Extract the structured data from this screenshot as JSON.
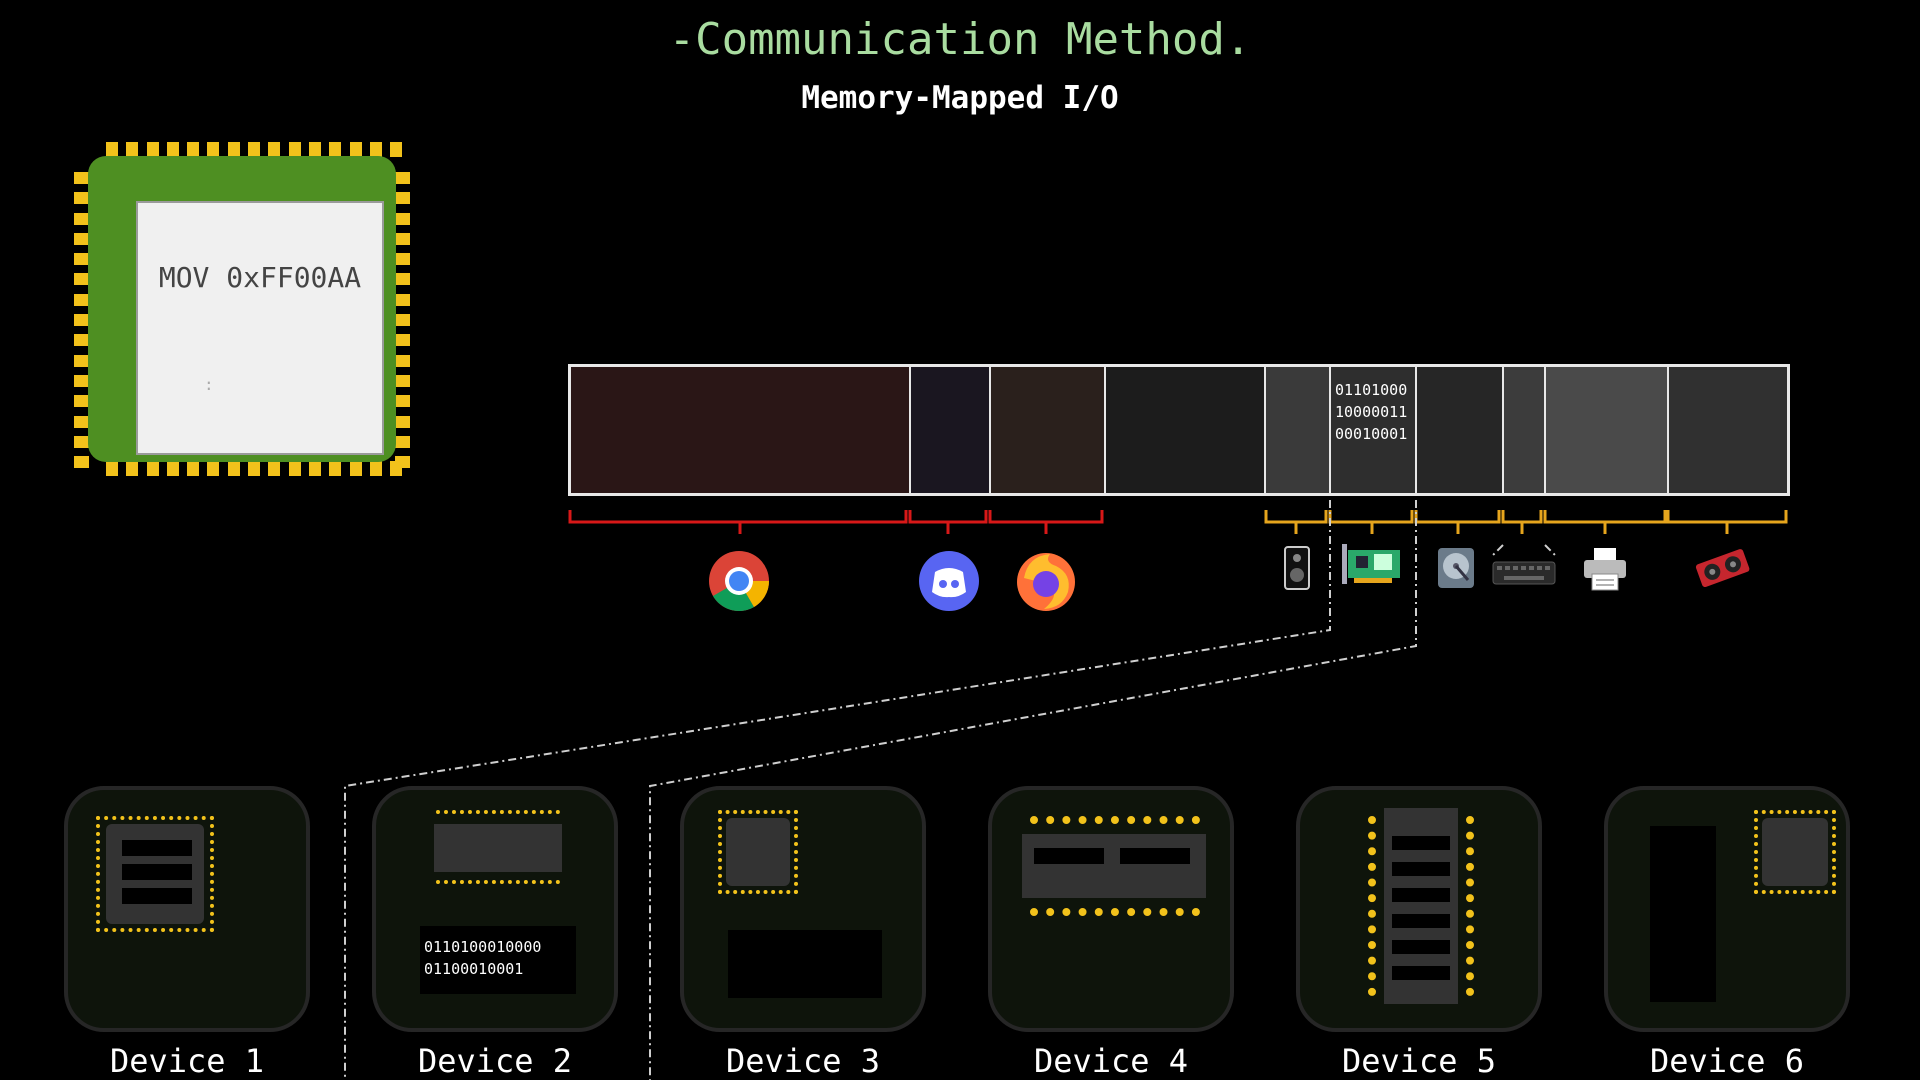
{
  "title": "-Communication Method.",
  "subtitle": "Memory-Mapped I/O",
  "cpu": {
    "instruction": "MOV 0xFF00AA",
    "cursor": ":"
  },
  "memory": {
    "segment_colors": [
      "#2a1616",
      "#1a1620",
      "#2a201c",
      "#1c1c1c",
      "#3a3a3a",
      "#2e2e2e",
      "#262626",
      "#3c3c3c",
      "#4a4a4a",
      "#303030"
    ],
    "bits_segment": "01101000\n10000011\n00010001"
  },
  "colors": {
    "title": "#a9dca0",
    "app_bracket": "#d81818",
    "device_bracket": "#e6a51d",
    "chip_pins": "#f2c21b",
    "cpu_board": "#4e8f22"
  },
  "icons": [
    "chrome-icon",
    "discord-icon",
    "firefox-icon",
    "speaker-icon",
    "network-card-icon",
    "hard-drive-icon",
    "keyboard-icon",
    "printer-icon",
    "graphics-card-icon"
  ],
  "devices": [
    {
      "label": "Device 1"
    },
    {
      "label": "Device 2",
      "bits": "0110100010000\n01100010001"
    },
    {
      "label": "Device 3"
    },
    {
      "label": "Device 4"
    },
    {
      "label": "Device 5"
    },
    {
      "label": "Device 6"
    }
  ]
}
